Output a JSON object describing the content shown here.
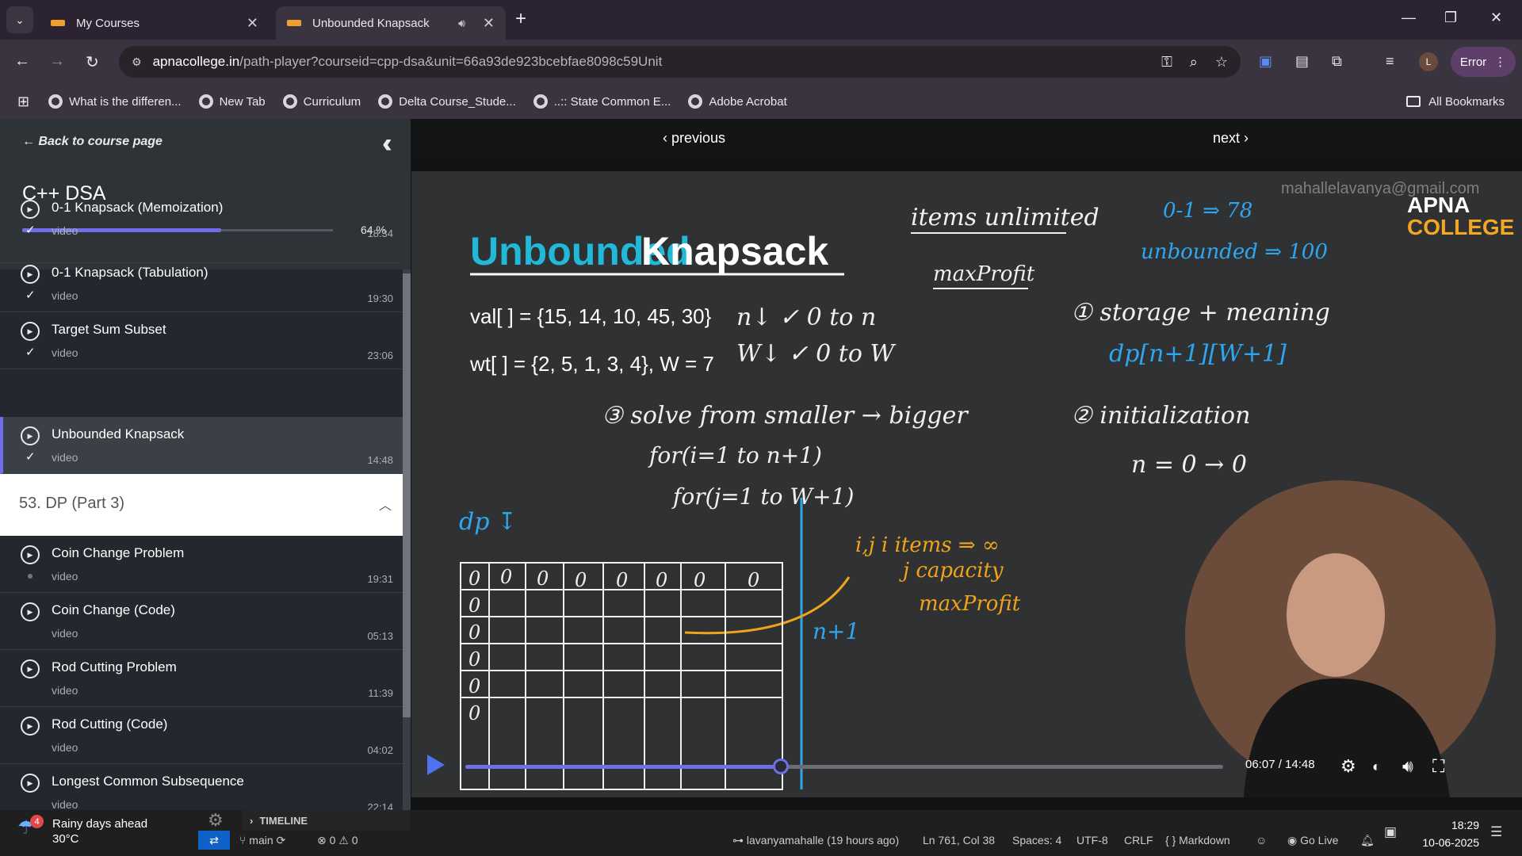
{
  "browser": {
    "tabs": [
      {
        "title": "My Courses",
        "active": false
      },
      {
        "title": "Unbounded Knapsack",
        "active": true
      }
    ],
    "url_host": "apnacollege.in",
    "url_path": "/path-player?courseid=cpp-dsa&unit=66a93de923bcebfae8098c59Unit",
    "profile_initial": "L",
    "error_label": "Error",
    "bookmarks": [
      "What is the differen...",
      "New Tab",
      "Curriculum",
      "Delta Course_Stude...",
      "..:: State Common E...",
      "Adobe Acrobat"
    ],
    "all_bookmarks": "All Bookmarks"
  },
  "sidebar": {
    "back_label": "Back to course page",
    "course_title": "C++ DSA",
    "progress_label": "64 %",
    "progress_value": 0.64,
    "lessons_top": [
      {
        "title": "0-1 Knapsack (Memoization)",
        "type": "video",
        "duration": "18:34",
        "done": true
      },
      {
        "title": "0-1 Knapsack (Tabulation)",
        "type": "video",
        "duration": "19:30",
        "done": true
      },
      {
        "title": "Target Sum Subset",
        "type": "video",
        "duration": "23:06",
        "done": true
      },
      {
        "title": "Unbounded Knapsack",
        "type": "video",
        "duration": "14:48",
        "done": true,
        "active": true
      }
    ],
    "section_title": "53. DP (Part 3)",
    "lessons_bottom": [
      {
        "title": "Coin Change Problem",
        "type": "video",
        "duration": "19:31",
        "done": false
      },
      {
        "title": "Coin Change (Code)",
        "type": "video",
        "duration": "05:13",
        "done": false
      },
      {
        "title": "Rod Cutting Problem",
        "type": "video",
        "duration": "11:39",
        "done": false
      },
      {
        "title": "Rod Cutting (Code)",
        "type": "video",
        "duration": "04:02",
        "done": false
      },
      {
        "title": "Longest Common Subsequence",
        "type": "video",
        "duration": "22:14",
        "done": false
      }
    ]
  },
  "player": {
    "previous_label": "previous",
    "next_label": "next",
    "time_label": "06:07 / 14:48",
    "progress_value": 0.416,
    "board": {
      "title_part1": "Unbounded",
      "title_part2": "Knapsack",
      "val_line": "val[ ] = {15, 14, 10, 45, 30}",
      "wt_line": "wt[ ] = {2, 5, 1, 3, 4}, W = 7",
      "watermark": "mahallelavanya@gmail.com",
      "logo_line1": "APNA",
      "logo_line2": "COLLEGE",
      "notes": {
        "items_unlimited": "items unlimited",
        "max_profit": "maxProfit",
        "zero_one": "0-1 ⇒ 78",
        "unbounded": "unbounded ⇒ 100",
        "n_check": "n↓ ✓ 0 to n",
        "w_check": "W↓ ✓ 0 to W",
        "step1": "① storage + meaning",
        "dp_decl": "dp[n+1][W+1]",
        "step2": "② initialization",
        "n_zero": "n = 0 → 0",
        "step3": "③ solve from smaller → bigger",
        "for_i": "for(i=1 to n+1)",
        "for_j": "for(j=1 to W+1)",
        "dp_label": "dp ↧",
        "ij_note1": "i,j  i items ⇒ ∞",
        "ij_note2": "j capacity",
        "ij_note3": "maxProfit",
        "n_plus_1": "n+1"
      }
    }
  },
  "taskbar": {
    "weather_badge": "4",
    "weather_line1": "Rainy days ahead",
    "weather_line2": "30°C",
    "timeline_label": "TIMELINE",
    "branch": "main",
    "problems": "⊗ 0 ⚠ 0",
    "git_author": "lavanyamahalle (19 hours ago)",
    "cursor": "Ln 761, Col 38",
    "spaces": "Spaces: 4",
    "encoding": "UTF-8",
    "eol": "CRLF",
    "language": "{ } Markdown",
    "go_live": "Go Live",
    "time": "18:29",
    "date": "10-06-2025"
  }
}
